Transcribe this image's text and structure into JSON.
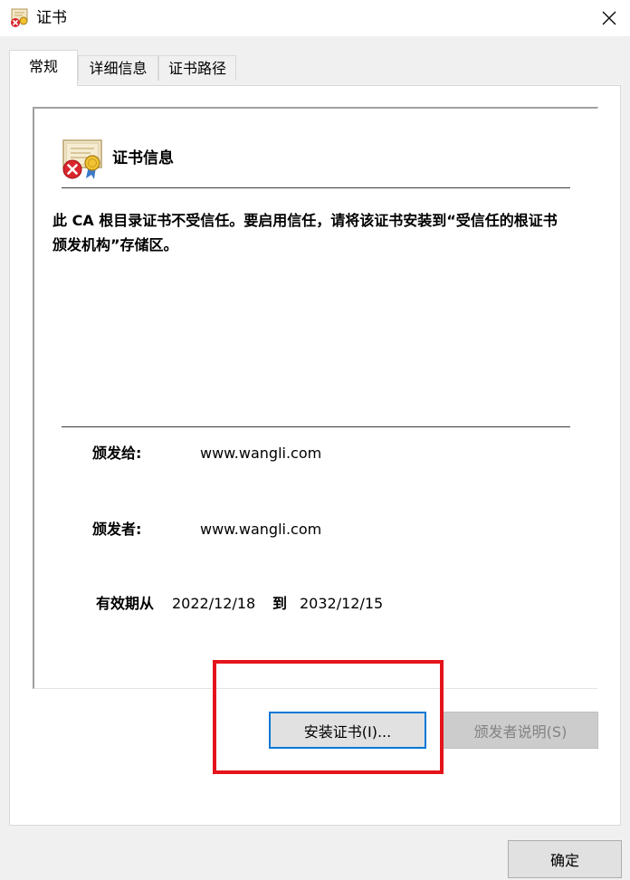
{
  "window": {
    "title": "证书",
    "title_icon": "certificate-error-icon",
    "close_icon": "close-icon"
  },
  "tabs": [
    {
      "label": "常规",
      "active": true
    },
    {
      "label": "详细信息",
      "active": false
    },
    {
      "label": "证书路径",
      "active": false
    }
  ],
  "info": {
    "heading": "证书信息",
    "icon": "certificate-error-icon",
    "message": "此 CA 根目录证书不受信任。要启用信任，请将该证书安装到“受信任的根证书颁发机构”存储区。",
    "issued_to_label": "颁发给:",
    "issued_to_value": "www.wangli.com",
    "issued_by_label": "颁发者:",
    "issued_by_value": "www.wangli.com",
    "valid_from_label": "有效期从",
    "valid_from": "2022/12/18",
    "valid_to_label": "到",
    "valid_to": "2032/12/15"
  },
  "buttons": {
    "install": "安装证书(I)...",
    "issuer_statement": "颁发者说明(S)",
    "ok": "确定"
  },
  "colors": {
    "highlight": "#e4141b",
    "focus_border": "#0078d7"
  }
}
